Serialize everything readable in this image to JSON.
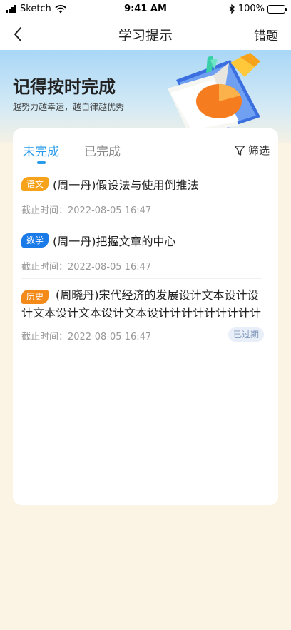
{
  "status_bar": {
    "carrier": "Sketch",
    "time": "9:41 AM",
    "battery": "100%"
  },
  "nav": {
    "title": "学习提示",
    "action_label": "错题"
  },
  "hero": {
    "title": "记得按时完成",
    "subtitle": "越努力越幸运，越自律越优秀"
  },
  "tabs": [
    {
      "label": "未完成",
      "active": true
    },
    {
      "label": "已完成",
      "active": false
    }
  ],
  "filter_label": "筛选",
  "tasks": [
    {
      "subject": "语文",
      "subject_color": "#f7a21b",
      "title": "(周一丹)假设法与使用倒推法",
      "deadline": "截止时间：2022-08-05 16:47"
    },
    {
      "subject": "数学",
      "subject_color": "#1a7ae8",
      "title": "(周一丹)把握文章的中心",
      "deadline": "截止时间：2022-08-05 16:47"
    },
    {
      "subject": "历史",
      "subject_color": "#f38a1a",
      "title": "(周晓丹)宋代经济的发展设计文本设计设计文本设计文本设计文本设计计计计计计计计计",
      "deadline": "截止时间：2022-08-05 16:47",
      "status": "已过期"
    }
  ],
  "icons": {
    "back": "chevron-left-icon",
    "filter": "filter-icon",
    "signal": "signal-icon",
    "wifi": "wifi-icon",
    "bluetooth": "bluetooth-icon",
    "battery": "battery-icon"
  },
  "colors": {
    "accent": "#2a9bea",
    "page_bg": "#fbf3e4",
    "hero_bg": "#a9d7f7"
  }
}
